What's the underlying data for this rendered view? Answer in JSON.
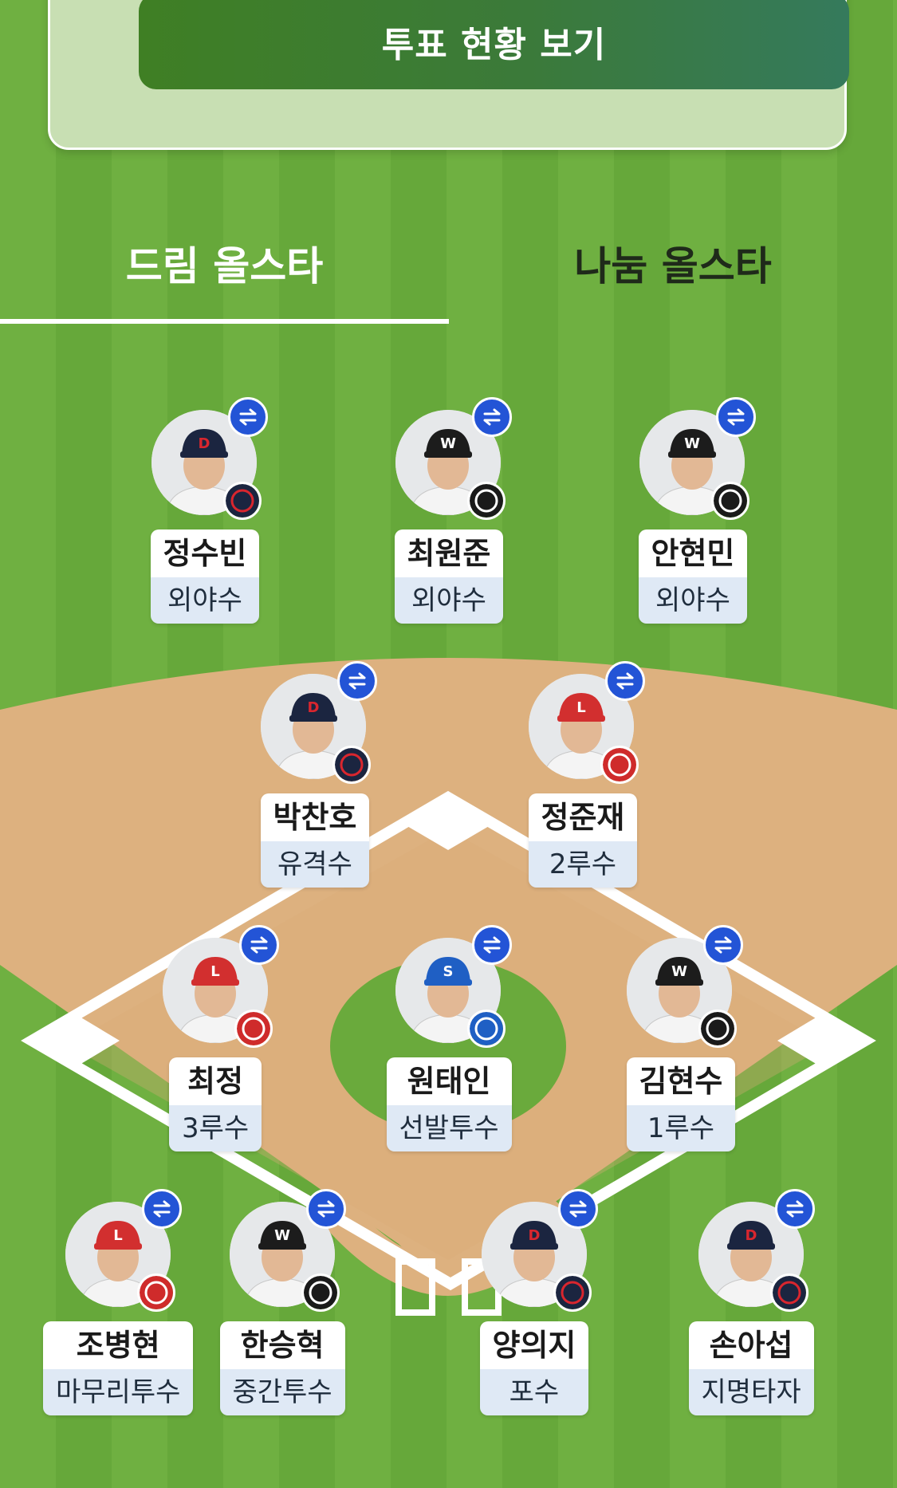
{
  "vote_button_label": "투표 현황 보기",
  "tabs": [
    {
      "label": "드림 올스타",
      "selected": true
    },
    {
      "label": "나눔 올스타",
      "selected": false
    }
  ],
  "colors": {
    "grass": "#6aaa3c",
    "dirt": "#ddb17f",
    "swap_badge": "#2354d6",
    "vote_button": "#3f7f24"
  },
  "players": [
    {
      "name": "정수빈",
      "position": "외야수",
      "team": "Bears",
      "cap": "doosan"
    },
    {
      "name": "최원준",
      "position": "외야수",
      "team": "kt wiz",
      "cap": "kt"
    },
    {
      "name": "안현민",
      "position": "외야수",
      "team": "kt wiz",
      "cap": "kt"
    },
    {
      "name": "박찬호",
      "position": "유격수",
      "team": "Bears",
      "cap": "doosan"
    },
    {
      "name": "정준재",
      "position": "2루수",
      "team": "Landers",
      "cap": "ssg"
    },
    {
      "name": "최정",
      "position": "3루수",
      "team": "Landers",
      "cap": "ssg"
    },
    {
      "name": "원태인",
      "position": "선발투수",
      "team": "Lions",
      "cap": "samsung"
    },
    {
      "name": "김현수",
      "position": "1루수",
      "team": "kt wiz",
      "cap": "kt"
    },
    {
      "name": "조병현",
      "position": "마무리투수",
      "team": "Landers",
      "cap": "ssg"
    },
    {
      "name": "한승혁",
      "position": "중간투수",
      "team": "kt wiz",
      "cap": "kt"
    },
    {
      "name": "양의지",
      "position": "포수",
      "team": "Bears",
      "cap": "doosan"
    },
    {
      "name": "손아섭",
      "position": "지명타자",
      "team": "Bears",
      "cap": "doosan"
    }
  ],
  "icons": {
    "swap": "swap-arrows-icon"
  }
}
